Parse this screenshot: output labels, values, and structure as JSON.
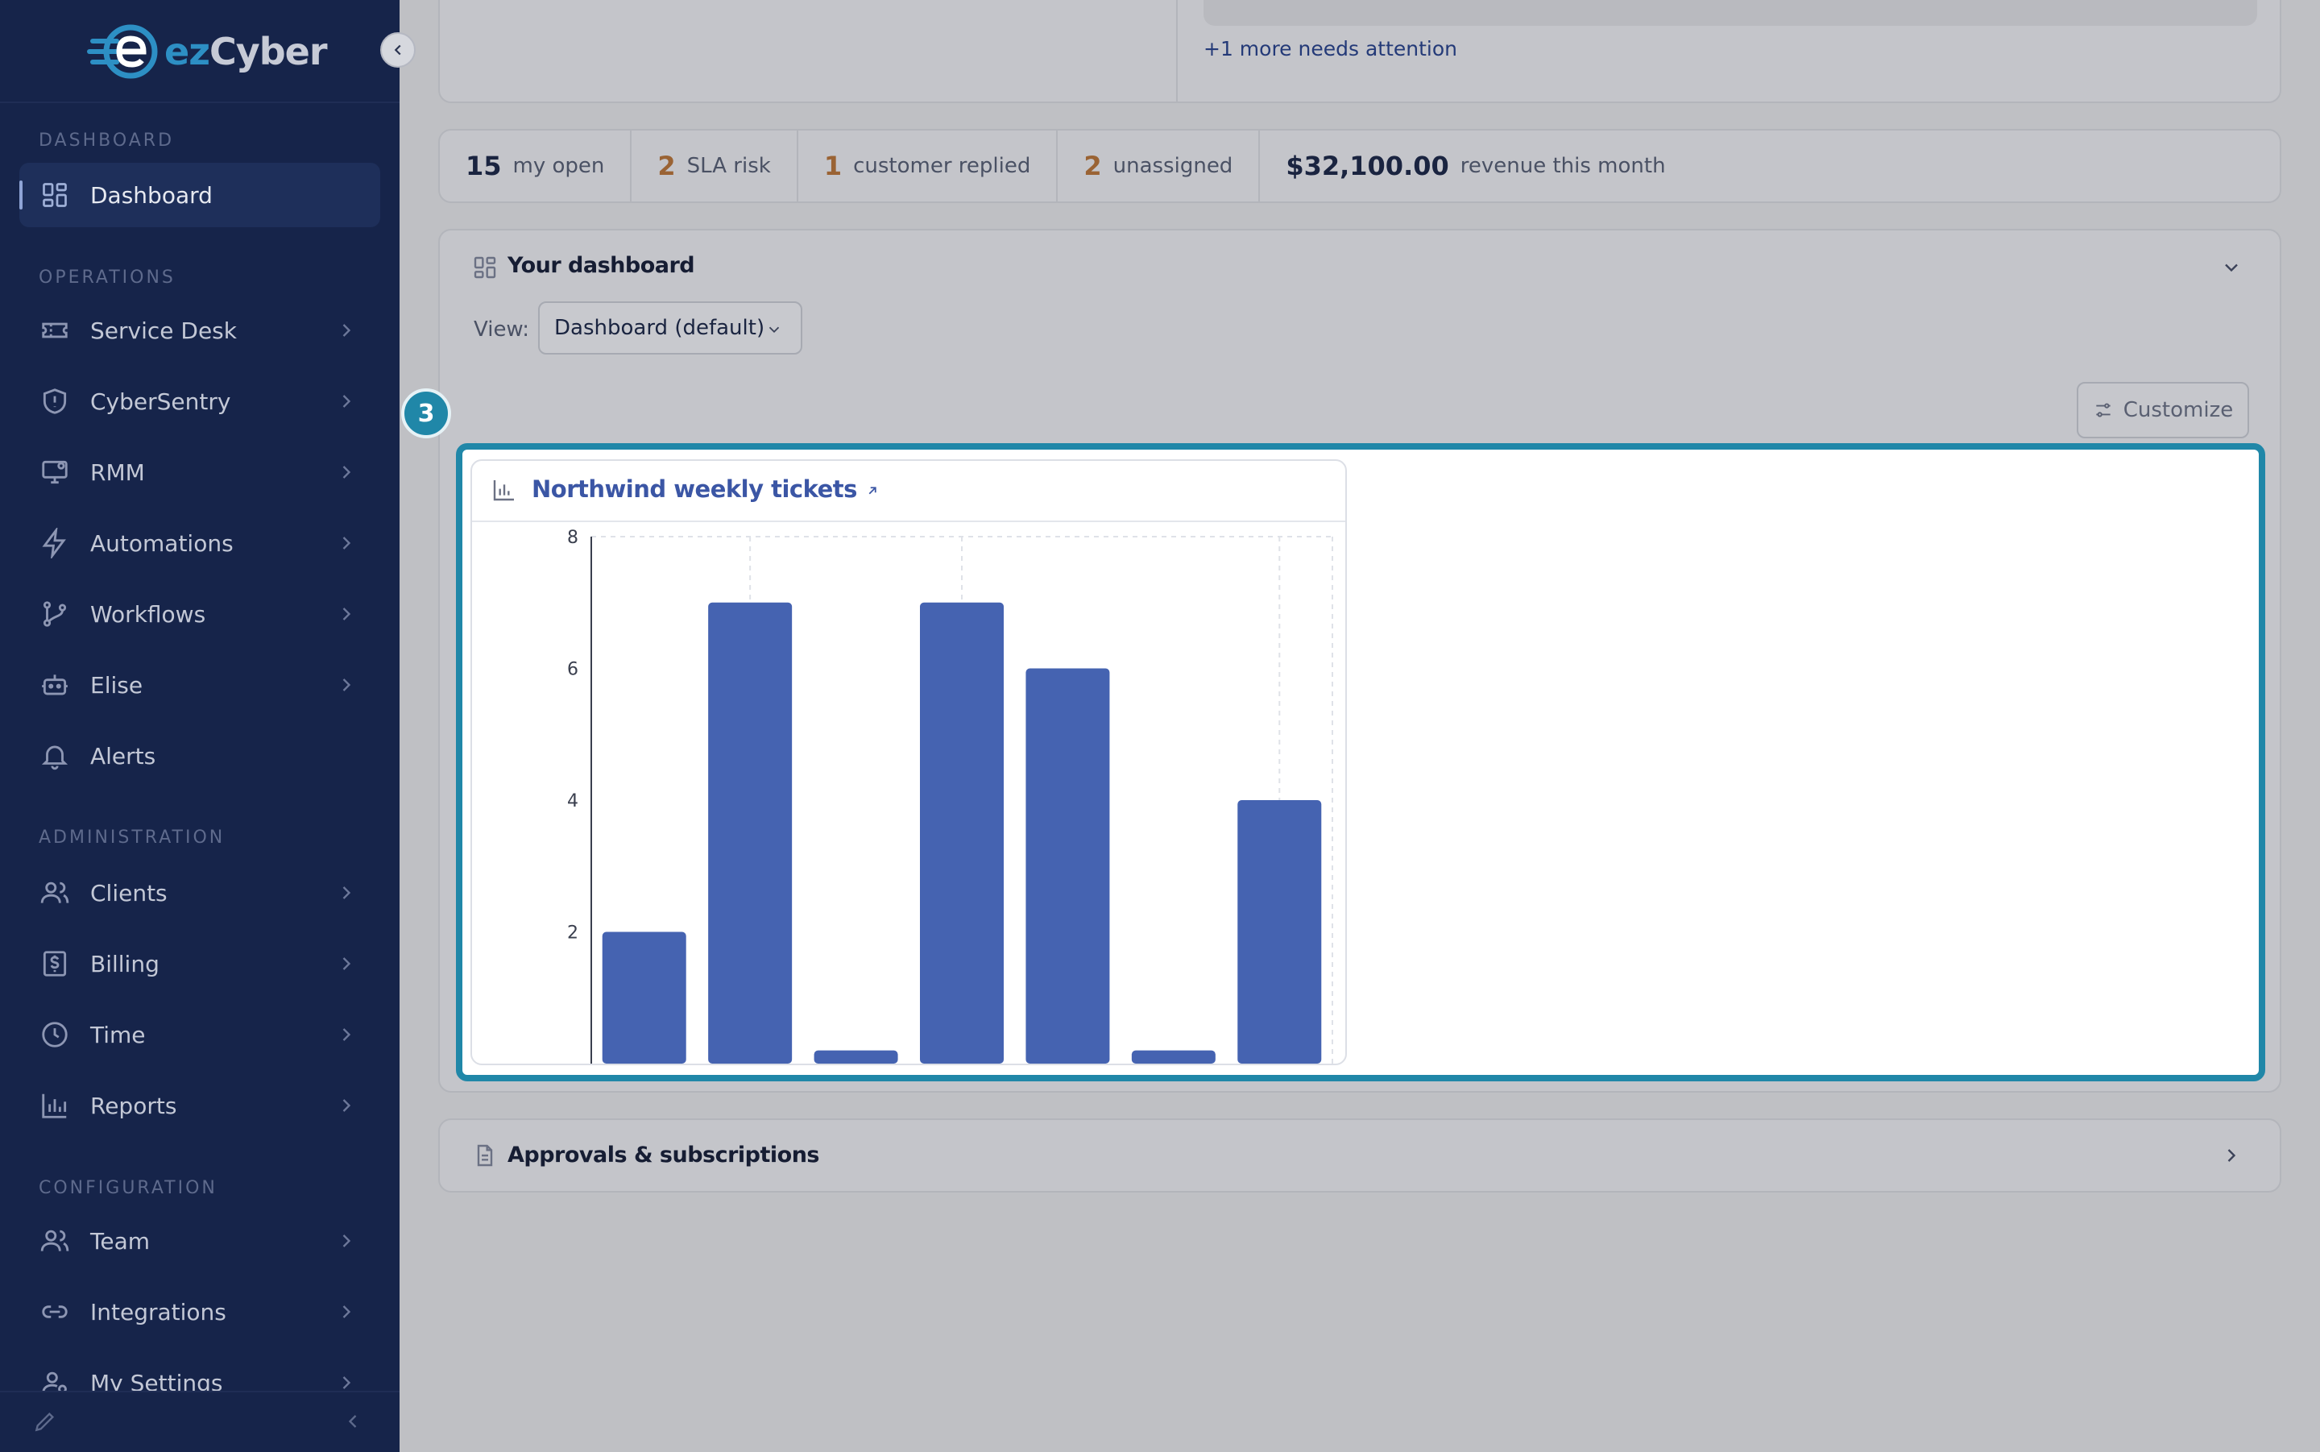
{
  "brand": {
    "name_prefix": "ez",
    "name_suffix": "Cyber"
  },
  "sidebar": {
    "sections": {
      "dashboard": "DASHBOARD",
      "operations": "OPERATIONS",
      "administration": "ADMINISTRATION",
      "configuration": "CONFIGURATION"
    },
    "items": {
      "dashboard": "Dashboard",
      "service_desk": "Service Desk",
      "cybersentry": "CyberSentry",
      "rmm": "RMM",
      "automations": "Automations",
      "workflows": "Workflows",
      "elise": "Elise",
      "alerts": "Alerts",
      "clients": "Clients",
      "billing": "Billing",
      "time": "Time",
      "reports": "Reports",
      "team": "Team",
      "integrations": "Integrations",
      "my_settings": "My Settings"
    }
  },
  "attention": {
    "more_link": "+1 more needs attention"
  },
  "stats": [
    {
      "num": "15",
      "label": "my open",
      "color": "#1a2440"
    },
    {
      "num": "2",
      "label": "SLA risk",
      "color": "#9a6334"
    },
    {
      "num": "1",
      "label": "customer replied",
      "color": "#9a6334"
    },
    {
      "num": "2",
      "label": "unassigned",
      "color": "#9a6334"
    },
    {
      "num": "$32,100.00",
      "label": "revenue this month",
      "color": "#1a2440"
    }
  ],
  "dashboard": {
    "title": "Your dashboard",
    "view_label": "View:",
    "view_value": "Dashboard (default)",
    "customize_label": "Customize",
    "step_badge": "3"
  },
  "widget": {
    "title": "Northwind weekly tickets"
  },
  "chart_data": {
    "type": "bar",
    "values": [
      2,
      7,
      0.2,
      7,
      6,
      0.2,
      4
    ],
    "ylim": [
      0,
      8
    ],
    "y_ticks": [
      "2",
      "4",
      "6",
      "8"
    ],
    "grid": true,
    "bar_color": "#4563b1"
  },
  "approvals": {
    "title": "Approvals & subscriptions"
  },
  "colors": {
    "accent": "#2087a8",
    "sidebar_bg": "#16244a",
    "bar": "#4563b1"
  }
}
